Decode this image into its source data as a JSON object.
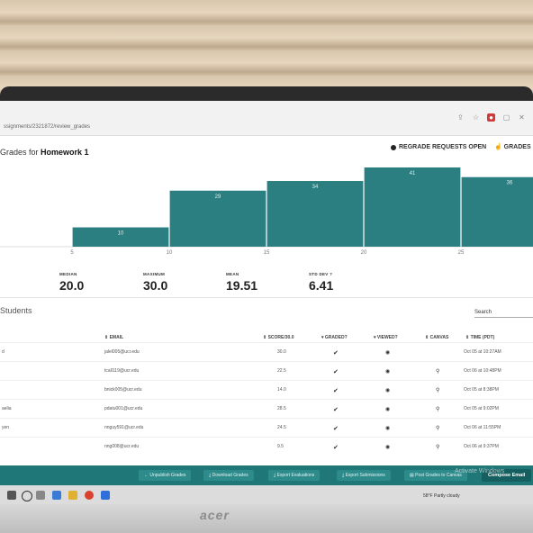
{
  "browser": {
    "url": "ssignments/2321872/review_grades"
  },
  "header": {
    "title_prefix": "Grades for",
    "title_assignment": "Homework 1",
    "regrade_label": "REGRADE REQUESTS OPEN",
    "grades_menu_label": "GRADES"
  },
  "chart_data": {
    "type": "bar",
    "title": "",
    "x_ticks": [
      "5",
      "10",
      "15",
      "20",
      "25"
    ],
    "bins": [
      {
        "range": [
          5,
          10
        ],
        "count": 10
      },
      {
        "range": [
          10,
          15
        ],
        "count": 29
      },
      {
        "range": [
          15,
          20
        ],
        "count": 34
      },
      {
        "range": [
          20,
          25
        ],
        "count": 41
      },
      {
        "range": [
          25,
          30
        ],
        "count": 36
      }
    ],
    "bar_color": "#2b7f80"
  },
  "stats": {
    "median_label": "MEDIAN",
    "median_value": "20.0",
    "maximum_label": "MAXIMUM",
    "maximum_value": "30.0",
    "mean_label": "MEAN",
    "mean_value": "19.51",
    "stddev_label": "STD DEV",
    "stddev_value": "6.41"
  },
  "students": {
    "title": "Students",
    "search_label": "Search"
  },
  "table": {
    "headers": {
      "email": "⇕ EMAIL",
      "score": "⇕ SCORE/30.0",
      "graded": "▾ GRADED?",
      "viewed": "▾ VIEWED?",
      "canvas": "⇕ CANVAS",
      "time": "⇕ TIME (PDT)"
    },
    "rows": [
      {
        "name": "d",
        "email": "jalel005@ucr.edu",
        "score": "30.0",
        "time": "Oct 05 at 10:27AM"
      },
      {
        "name": "",
        "email": "tcall119@ucr.edu",
        "score": "22.5",
        "time": "Oct 06 at 10:48PM"
      },
      {
        "name": "",
        "email": "bnick005@ucr.edu",
        "score": "14.0",
        "time": "Oct 05 at 8:38PM"
      },
      {
        "name": "aelia",
        "email": "pdatu001@ucr.edu",
        "score": "28.5",
        "time": "Oct 05 at 9:02PM"
      },
      {
        "name": "yen",
        "email": "nnguy591@ucr.edu",
        "score": "24.5",
        "time": "Oct 06 at 11:55PM"
      },
      {
        "name": "",
        "email": "nng008@ucr.edu",
        "score": "9.5",
        "time": "Oct 06 at 9:37PM"
      }
    ]
  },
  "footer": {
    "unpublish": "← Unpublish Grades",
    "download": "⤓ Download Grades",
    "export_eval": "⤓ Export Evaluations",
    "export_sub": "⤓ Export Submissions",
    "post_canvas": "▤ Post Grades to Canvas",
    "compose": "Compose Email",
    "watermark": "Activate Windows"
  },
  "taskbar": {
    "weather": "58°F Partly cloudy"
  },
  "monitor": {
    "brand": "acer"
  }
}
